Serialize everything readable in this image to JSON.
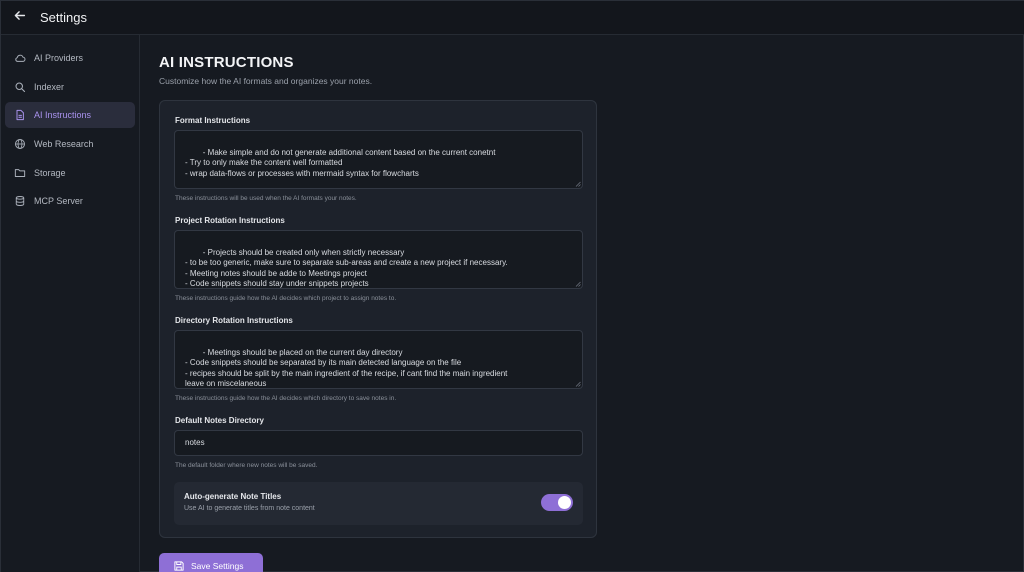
{
  "app": {
    "title": "Settings",
    "back_icon": "arrow-left-icon"
  },
  "sidebar": {
    "items": [
      {
        "label": "AI Providers",
        "icon": "cloud-icon",
        "active": false
      },
      {
        "label": "Indexer",
        "icon": "search-icon",
        "active": false
      },
      {
        "label": "AI Instructions",
        "icon": "document-icon",
        "active": true
      },
      {
        "label": "Web Research",
        "icon": "globe-icon",
        "active": false
      },
      {
        "label": "Storage",
        "icon": "folder-icon",
        "active": false
      },
      {
        "label": "MCP Server",
        "icon": "database-icon",
        "active": false
      }
    ]
  },
  "page": {
    "title": "AI INSTRUCTIONS",
    "subtitle": "Customize how the AI formats and organizes your notes."
  },
  "form": {
    "format": {
      "label": "Format Instructions",
      "value": "- Make simple and do not generate additional content based on the current conetnt\n- Try to only make the content well formatted\n- wrap data-flows or processes with mermaid syntax for flowcharts",
      "helper": "These instructions will be used when the AI formats your notes."
    },
    "project_rotation": {
      "label": "Project Rotation Instructions",
      "value": "- Projects should be created only when strictly necessary\n- to be too generic, make sure to separate sub-areas and create a new project if necessary.\n- Meeting notes should be adde to Meetings project\n- Code snippets should stay under snippets projects\n- Recipes should be on personal project",
      "helper": "These instructions guide how the AI decides which project to assign notes to."
    },
    "directory_rotation": {
      "label": "Directory Rotation Instructions",
      "value": "- Meetings should be placed on the current day directory\n- Code snippets should be separated by its main detected language on the file\n- recipes should be split by the main ingredient of the recipe, if cant find the main ingredient\nleave on miscelaneous",
      "helper": "These instructions guide how the AI decides which directory to save notes in."
    },
    "default_dir": {
      "label": "Default Notes Directory",
      "value": "notes",
      "helper": "The default folder where new notes will be saved."
    },
    "auto_titles": {
      "title": "Auto-generate Note Titles",
      "description": "Use AI to generate titles from note content",
      "enabled": true
    }
  },
  "actions": {
    "save_label": "Save Settings",
    "save_icon": "floppy-disk-icon"
  },
  "colors": {
    "accent": "#8e6fd6",
    "active_text": "#a992ee",
    "background": "#161a21",
    "card": "#1d222b"
  }
}
